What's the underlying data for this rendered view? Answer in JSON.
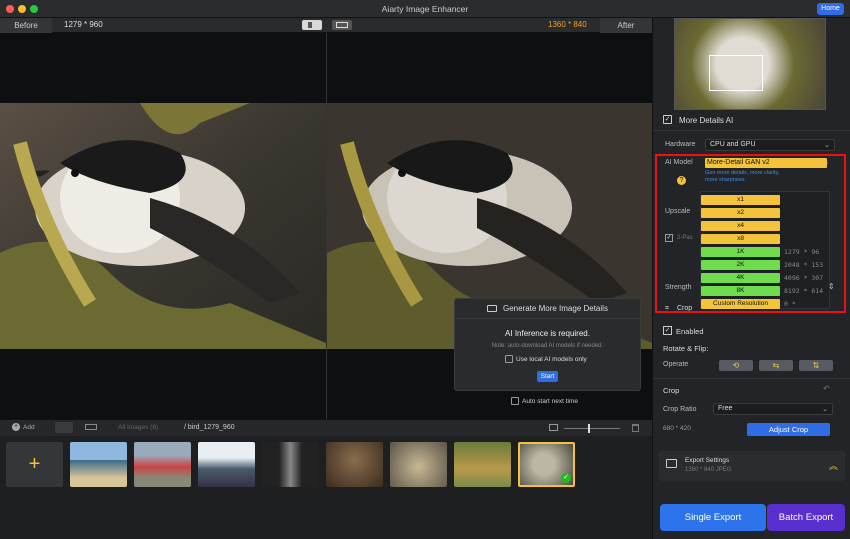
{
  "window": {
    "title": "Aiarty Image Enhancer",
    "home_label": "Home"
  },
  "topbar": {
    "before_label": "Before",
    "before_size": "1279 * 960",
    "after_size": "1360 * 840",
    "after_label": "After"
  },
  "popup": {
    "title": "Generate More Image Details",
    "required": "AI Inference is required.",
    "note": "Note: auto-download AI models if needed.",
    "use_local": "Use local AI models only",
    "start": "Start",
    "auto_start": "Auto start next time"
  },
  "strip": {
    "add": "Add",
    "all_images": "All Images (8)",
    "path": "/ bird_1279_960"
  },
  "panel": {
    "more_details": "More Details AI",
    "hardware_label": "Hardware",
    "hardware_value": "CPU and GPU",
    "ai_model_label": "AI Model",
    "ai_model_value": "More-Detail GAN  v2",
    "ai_model_desc": "Gen more details, more clarity, more sharpness.",
    "help": "?",
    "upscale_label": "Upscale",
    "two_pass": "2-Pas",
    "strength_label": "Strength",
    "crop_header": "Crop",
    "enabled": "Enabled",
    "rotate_flip": "Rotate & Flip:",
    "operate": "Operate",
    "crop_label": "Crop",
    "crop_ratio_label": "Crop Ratio",
    "crop_ratio_value": "Free",
    "crop_size": "680 * 420",
    "adjust_crop": "Adjust Crop",
    "export_settings": "Export Settings",
    "export_info": "1360 * 840  JPEG",
    "single_export": "Single Export",
    "batch_export": "Batch Export"
  },
  "menu": {
    "items": [
      {
        "label": "x1",
        "res": "",
        "color": "#f3c33b"
      },
      {
        "label": "x2",
        "res": "",
        "color": "#f3c33b"
      },
      {
        "label": "x4",
        "res": "",
        "color": "#f3c33b"
      },
      {
        "label": "x8",
        "res": "",
        "color": "#f3c33b"
      },
      {
        "label": "1K",
        "res": "1279 * 96",
        "color": "#6fdc4f"
      },
      {
        "label": "2K",
        "res": "2048 * 153",
        "color": "#6fdc4f"
      },
      {
        "label": "4K",
        "res": "4096 * 307",
        "color": "#6fdc4f"
      },
      {
        "label": "8K",
        "res": "8192 * 614",
        "color": "#6fdc4f"
      },
      {
        "label": "Custom Resolution",
        "res": "0 *",
        "color": "#f3c33b"
      }
    ]
  },
  "colors": {
    "accent": "#2f6de6",
    "highlight": "#e11111",
    "yellow": "#f3c33b",
    "green": "#6fdc4f"
  }
}
